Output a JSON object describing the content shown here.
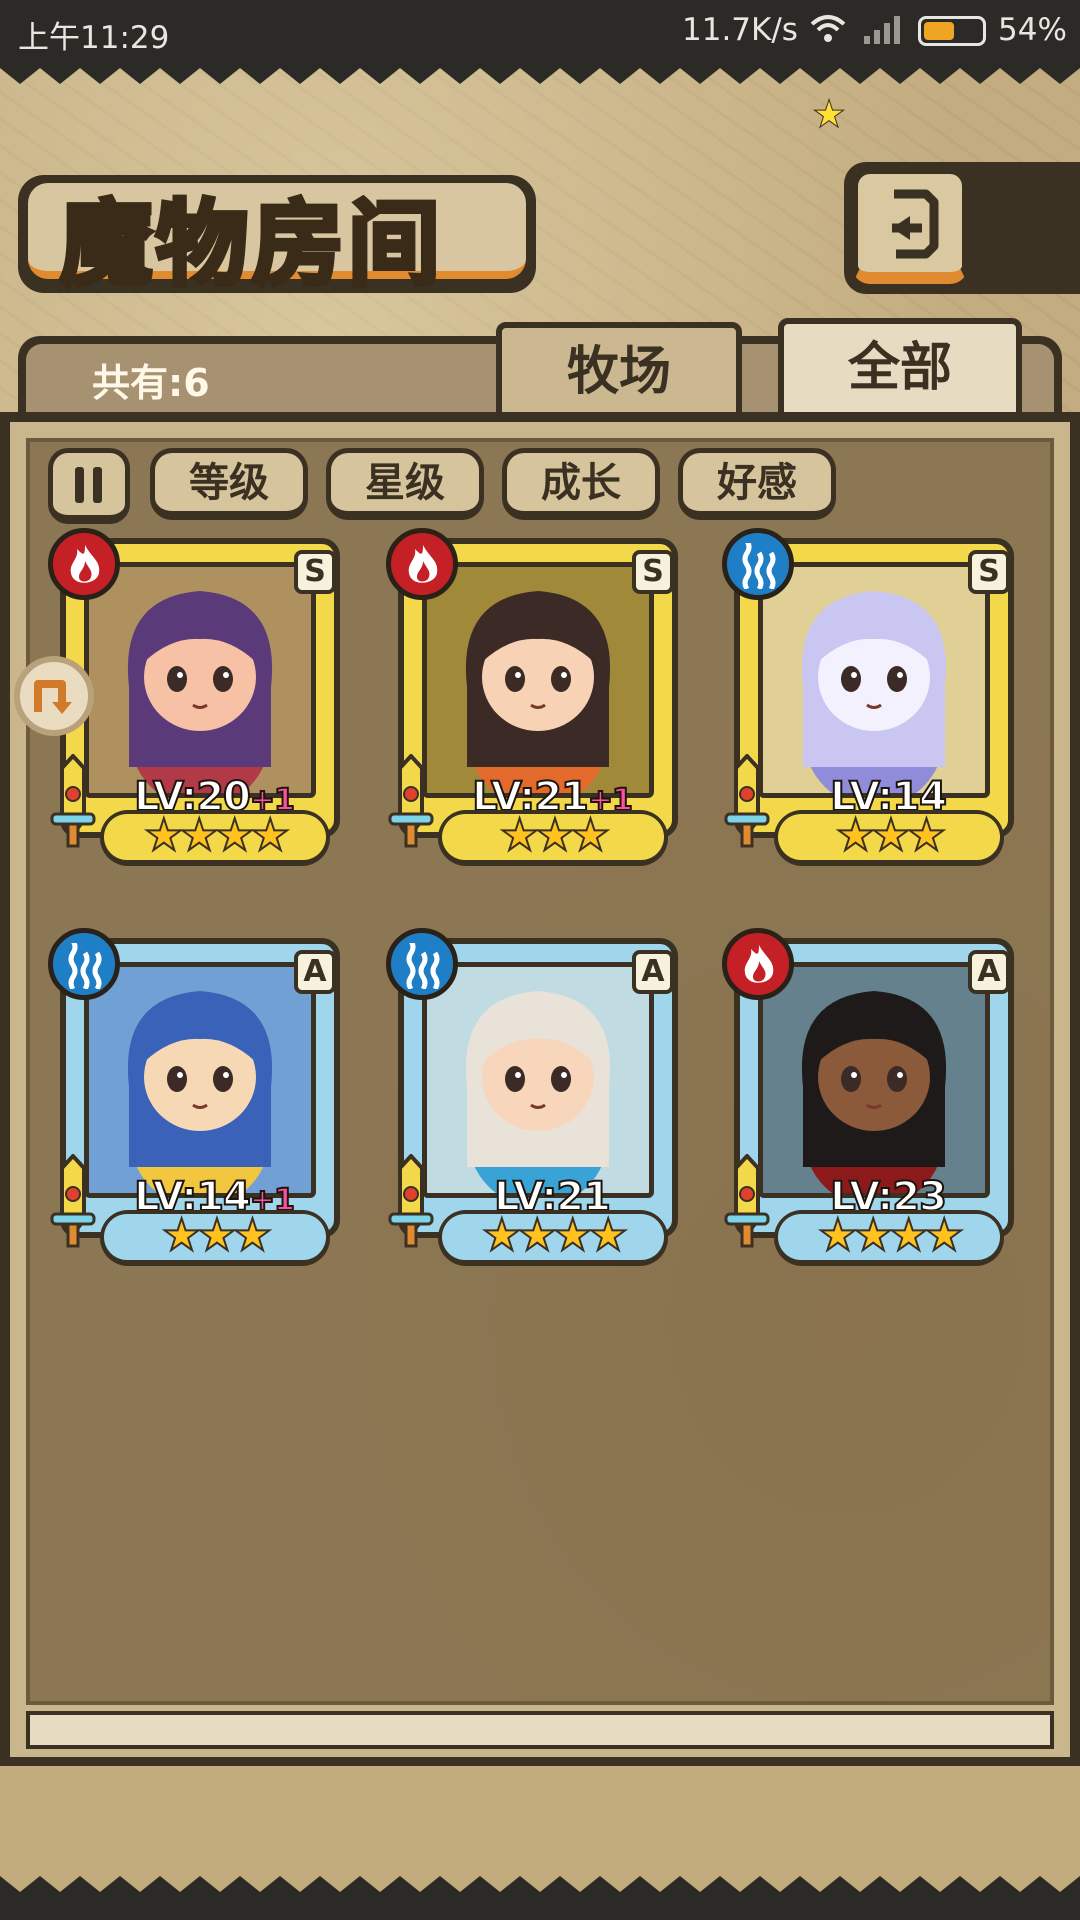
{
  "status_bar": {
    "time": "上午11:29",
    "net_speed": "11.7K/s",
    "battery_level": 0.54,
    "battery_pct": "54%",
    "battery_color": "#f0a424"
  },
  "header": {
    "title": "魔物房间",
    "back_icon": "return-arrow-icon"
  },
  "tabs": {
    "total_label": "共有:6",
    "ranch_label": "牧场",
    "all_label": "全部",
    "active": "全部"
  },
  "sort": {
    "toggle_icon": "pause-icon",
    "buttons": [
      "等级",
      "星级",
      "成长",
      "好感"
    ]
  },
  "monsters": [
    {
      "element": "fire",
      "rank": "S",
      "level": "LV:20",
      "bonus": "+1",
      "stars": 4,
      "frame": "gold"
    },
    {
      "element": "fire",
      "rank": "S",
      "level": "LV:21",
      "bonus": "+1",
      "stars": 3,
      "frame": "gold"
    },
    {
      "element": "water",
      "rank": "S",
      "level": "LV:14",
      "bonus": "",
      "stars": 3,
      "frame": "gold"
    },
    {
      "element": "water",
      "rank": "A",
      "level": "LV:14",
      "bonus": "+1",
      "stars": 3,
      "frame": "blue"
    },
    {
      "element": "water",
      "rank": "A",
      "level": "LV:21",
      "bonus": "",
      "stars": 4,
      "frame": "blue"
    },
    {
      "element": "fire",
      "rank": "A",
      "level": "LV:23",
      "bonus": "",
      "stars": 4,
      "frame": "blue"
    }
  ],
  "colors": {
    "gold_frame": "#f3d94a",
    "blue_frame": "#9fd6ec",
    "fire": "#c42026",
    "water": "#1f7fc6",
    "level_bonus": "#ff4fa3"
  }
}
